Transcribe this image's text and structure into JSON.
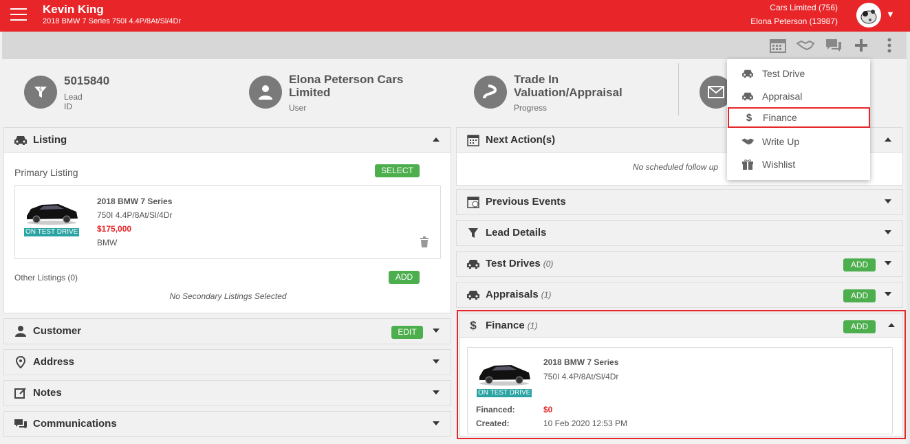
{
  "header": {
    "lead_name": "Kevin King",
    "vehicle": "2018 BMW 7 Series 750I 4.4P/8At/Sl/4Dr",
    "account_line1": "Cars Limited (756)",
    "account_line2": "Elona Peterson (13987)"
  },
  "toolbar": {
    "icons": [
      "calendar-icon",
      "handshake-icon",
      "chat-icon",
      "plus-icon",
      "more-vertical-icon"
    ]
  },
  "summary": {
    "lead_id_value": "5015840",
    "lead_id_label": "Lead ID",
    "user_value": "Elona Peterson Cars Limited",
    "user_label": "User",
    "progress_value": "Trade In Valuation/Appraisal",
    "progress_label": "Progress"
  },
  "listing": {
    "title": "Listing",
    "primary_label": "Primary Listing",
    "select_label": "SELECT",
    "car_title": "2018 BMW 7 Series",
    "car_sub": "750I 4.4P/8At/Sl/4Dr",
    "car_price": "$175,000",
    "car_make": "BMW",
    "badge": "ON TEST DRIVE",
    "other_label": "Other Listings (0)",
    "add_label": "ADD",
    "no_secondary": "No Secondary Listings Selected"
  },
  "left_panels": {
    "customer": "Customer",
    "customer_edit": "EDIT",
    "address": "Address",
    "notes": "Notes",
    "communications": "Communications"
  },
  "right_panels": {
    "next_actions": "Next Action(s)",
    "no_followup": "No scheduled follow up",
    "previous_events": "Previous Events",
    "lead_details": "Lead Details",
    "test_drives": "Test Drives",
    "test_drives_count": "(0)",
    "appraisals": "Appraisals",
    "appraisals_count": "(1)",
    "finance": "Finance",
    "finance_count": "(1)",
    "add_label": "ADD"
  },
  "finance_card": {
    "car_title": "2018 BMW 7 Series",
    "car_sub": "750I 4.4P/8At/Sl/4Dr",
    "badge": "ON TEST DRIVE",
    "financed_label": "Financed:",
    "financed_value": "$0",
    "created_label": "Created:",
    "created_value": "10 Feb 2020 12:53 PM"
  },
  "menu": {
    "items": [
      {
        "label": "Test Drive",
        "icon": "car-icon"
      },
      {
        "label": "Appraisal",
        "icon": "car-tag-icon"
      },
      {
        "label": "Finance",
        "icon": "dollar-icon"
      },
      {
        "label": "Write Up",
        "icon": "handshake-icon"
      },
      {
        "label": "Wishlist",
        "icon": "gift-icon"
      }
    ]
  },
  "colors": {
    "brand_red": "#e8262a",
    "green": "#4cae4c",
    "teal": "#2aa3a3"
  }
}
